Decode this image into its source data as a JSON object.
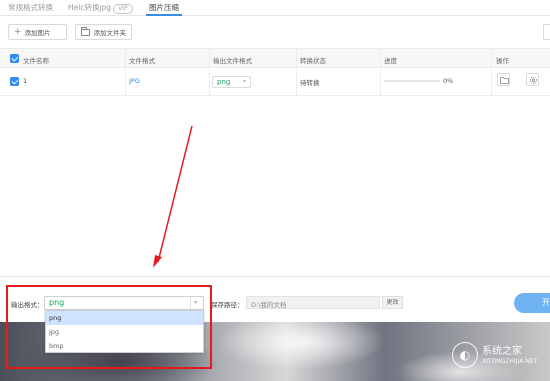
{
  "tabs": [
    {
      "label": "常规格式转换"
    },
    {
      "label": "Heic转换jpg",
      "badge": "VIP"
    },
    {
      "label": "图片压缩"
    }
  ],
  "toolbar": {
    "add_image_label": "添加图片",
    "add_folder_label": "添加文件夹"
  },
  "table": {
    "headers": [
      "文件名称",
      "文件格式",
      "输出文件格式",
      "转换状态",
      "进度",
      "操作"
    ],
    "rows": [
      {
        "name": "1",
        "format": "JPG",
        "output_format": "png",
        "status": "待转换",
        "progress_text": "0%",
        "progress": 0
      }
    ]
  },
  "bottom": {
    "output_format_label": "输出格式：",
    "output_format_value": "png",
    "format_options": [
      "png",
      "jpg",
      "bmp"
    ],
    "selected_option": "png",
    "save_path_label": "保存路径：",
    "save_path_value": "D:\\我的文档",
    "change_label": "更改",
    "start_label": "开"
  },
  "watermark": {
    "name": "系统之家",
    "url": "XITONGZHIJIA.NET"
  },
  "colors": {
    "accent": "#2d8cf0",
    "format_green": "#19a15f",
    "annotation_red": "#e51b1b"
  }
}
